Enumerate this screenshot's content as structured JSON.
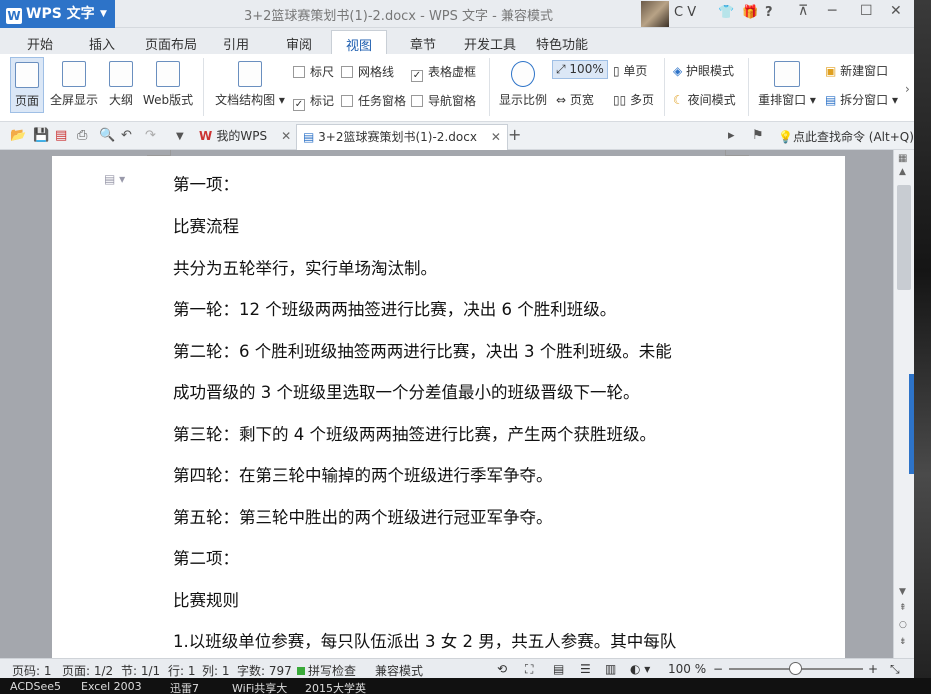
{
  "titlebar": {
    "app_button": "WPS 文字",
    "doc_title": "3+2篮球赛策划书(1)-2.docx - WPS 文字 - 兼容模式",
    "user_label": "C V"
  },
  "ribbon_tabs": [
    "开始",
    "插入",
    "页面布局",
    "引用",
    "审阅",
    "视图",
    "章节",
    "开发工具",
    "特色功能"
  ],
  "active_tab": "视图",
  "ribbon": {
    "page_view": "页面",
    "fullscreen": "全屏显示",
    "outline": "大纲",
    "web_view": "Web版式",
    "doc_structure": "文档结构图",
    "ruler": "标尺",
    "gridlines": "网格线",
    "table_gridlines": "表格虚框",
    "marks": "标记",
    "task_pane": "任务窗格",
    "nav_pane": "导航窗格",
    "zoom_label": "显示比例",
    "zoom_100": "100%",
    "page_width": "页宽",
    "one_page": "单页",
    "multi_page": "多页",
    "eye_mode": "护眼模式",
    "night_mode": "夜间模式",
    "arrange": "重排窗口",
    "new_window": "新建窗口",
    "split_window": "拆分窗口"
  },
  "checkboxes": {
    "ruler": false,
    "gridlines": false,
    "table_gridlines": true,
    "marks": true,
    "task_pane": false,
    "nav_pane": false
  },
  "doc_tabs": [
    {
      "label": "我的WPS"
    },
    {
      "label": "3+2篮球赛策划书(1)-2.docx"
    }
  ],
  "search_hint": "点此查找命令 (Alt+Q)",
  "document": {
    "paragraphs": [
      "第一项：",
      "比赛流程",
      "共分为五轮举行，实行单场淘汰制。",
      "第一轮：12 个班级两两抽签进行比赛，决出 6 个胜利班级。",
      "第二轮：6 个胜利班级抽签两两进行比赛，决出 3 个胜利班级。未能",
      "成功晋级的 3 个班级里选取一个分差值最小的班级晋级下一轮。",
      "第三轮：剩下的 4 个班级两两抽签进行比赛，产生两个获胜班级。",
      "第四轮：在第三轮中输掉的两个班级进行季军争夺。",
      "第五轮：第三轮中胜出的两个班级进行冠亚军争夺。",
      "第二项：",
      "比赛规则",
      "1.以班级单位参赛，每只队伍派出 3 女 2 男，共五人参赛。其中每队"
    ]
  },
  "statusbar": {
    "page_no": "页码: 1",
    "page": "页面: 1/2",
    "section": "节: 1/1",
    "row": "行: 1",
    "col": "列: 1",
    "word_count": "字数: 797",
    "spell_check": "拼写检查",
    "compat_mode": "兼容模式",
    "zoom": "100 %",
    "zoom_level": 0.5
  },
  "taskbar": [
    "ACDSee5",
    "Excel 2003",
    "迅雷7",
    "WiFi共享大",
    "2015大学英"
  ]
}
